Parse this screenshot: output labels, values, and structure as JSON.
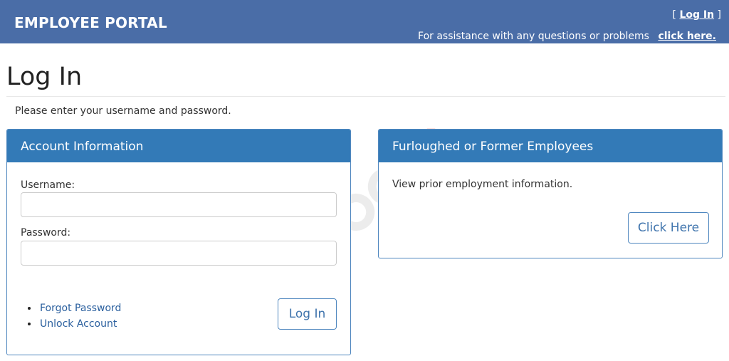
{
  "header": {
    "brand": "EMPLOYEE PORTAL",
    "login_open_bracket": "[",
    "login_link": "Log In",
    "login_close_bracket": "]",
    "assist_text": "For assistance with any questions or problems",
    "assist_link": "click here."
  },
  "page": {
    "title": "Log In",
    "intro": "Please enter your username and password."
  },
  "account_panel": {
    "heading": "Account Information",
    "username_label": "Username:",
    "username_value": "",
    "password_label": "Password:",
    "password_value": "",
    "links": [
      "Forgot Password",
      "Unlock Account"
    ],
    "login_button": "Log In"
  },
  "former_panel": {
    "heading": "Furloughed or Former Employees",
    "text": "View prior employment information.",
    "button": "Click Here"
  },
  "colors": {
    "header_bg": "#4a6da7",
    "panel_heading_bg": "#337ab7",
    "link": "#2a5f9e"
  }
}
